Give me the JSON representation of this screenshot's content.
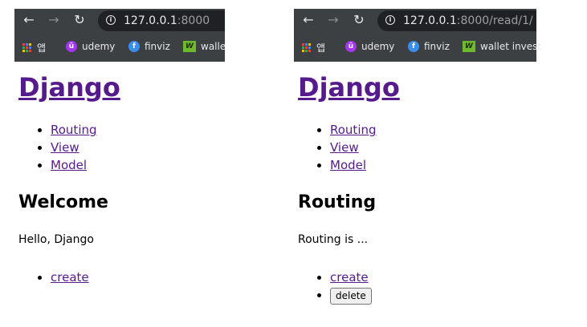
{
  "left": {
    "browser": {
      "url_host": "127.0.0.1",
      "url_path": ":8000",
      "bookmarks": [
        "앱",
        "udemy",
        "finviz",
        "walle"
      ]
    },
    "page": {
      "heading": "Django",
      "nav": [
        "Routing",
        "View",
        "Model"
      ],
      "title": "Welcome",
      "body": "Hello, Django",
      "create_link": "create"
    }
  },
  "right": {
    "browser": {
      "url_host": "127.0.0.1",
      "url_path": ":8000/read/1/",
      "bookmarks": [
        "앱",
        "udemy",
        "finviz",
        "wallet invest"
      ]
    },
    "page": {
      "heading": "Django",
      "nav": [
        "Routing",
        "View",
        "Model"
      ],
      "title": "Routing",
      "body": "Routing is ...",
      "create_link": "create",
      "delete_button": "delete"
    }
  },
  "icons": {
    "back": "back-arrow-icon",
    "forward": "forward-arrow-icon",
    "reload": "reload-icon",
    "info": "info-icon",
    "apps": "apps-grid-icon",
    "udemy": "udemy-icon",
    "finviz": "finviz-icon",
    "wallet": "wallet-investor-icon"
  },
  "colors": {
    "chrome_bg": "#3c4043",
    "omnibox_bg": "#202124",
    "visited_link": "#551a8b"
  }
}
